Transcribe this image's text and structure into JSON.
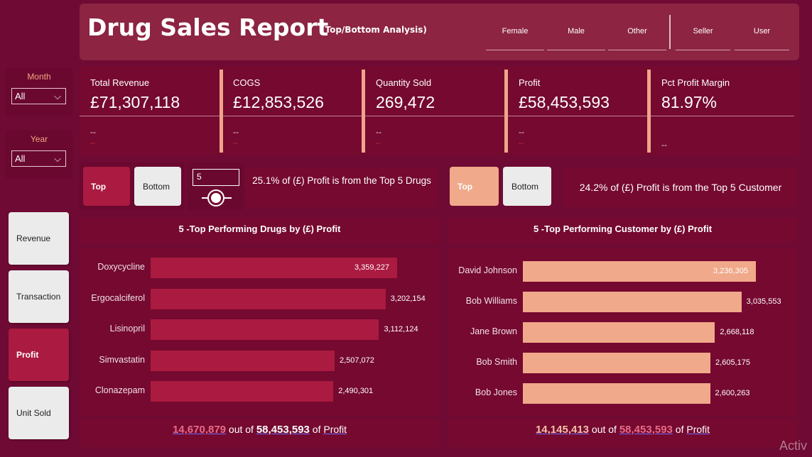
{
  "header": {
    "title": "Drug Sales Report",
    "subtitle": "(Top/Bottom Analysis)",
    "gender_slicers": [
      "Female",
      "Male",
      "Other"
    ],
    "role_slicers": [
      "Seller",
      "User"
    ]
  },
  "filters": {
    "month": {
      "label": "Month",
      "value": "All"
    },
    "year": {
      "label": "Year",
      "value": "All"
    }
  },
  "kpis": [
    {
      "label": "Total Revenue",
      "value": "£71,307,118",
      "dash": "--",
      "dash2": "--"
    },
    {
      "label": "COGS",
      "value": "£12,853,526",
      "dash": "--",
      "dash2": "--"
    },
    {
      "label": "Quantity Sold",
      "value": "269,472",
      "dash": "--",
      "dash2": "--"
    },
    {
      "label": "Profit",
      "value": "£58,453,593",
      "dash": "--",
      "dash2": "--"
    },
    {
      "label": "Pct Profit Margin",
      "value": "81.97%",
      "dash": "--"
    }
  ],
  "nav": [
    "Revenue",
    "Transaction",
    "Profit",
    "Unit Sold"
  ],
  "left": {
    "top_label": "Top",
    "bottom_label": "Bottom",
    "n_value": "5",
    "insight": "25.1% of (£) Profit is from the Top 5 Drugs",
    "chart_title": "5 -Top Performing Drugs by (£) Profit",
    "footer": {
      "part": "14,670,879",
      "out_of": "out of",
      "total": "58,453,593",
      "of": "of",
      "measure": "Profit"
    }
  },
  "right": {
    "top_label": "Top",
    "bottom_label": "Bottom",
    "insight": "24.2% of (£) Profit is from the Top 5 Customer",
    "chart_title": "5 -Top Performing Customer by (£) Profit",
    "footer": {
      "part": "14,145,413",
      "out_of": "out of",
      "total": "58,453,593",
      "of": "of",
      "measure": "Profit"
    }
  },
  "watermark": "Activ",
  "colors": {
    "bg": "#6e0a33",
    "drug_bar": "#ab1a40",
    "customer_bar": "#f0a98a",
    "accent": "#f0a58a"
  },
  "chart_data": [
    {
      "type": "bar",
      "orientation": "horizontal",
      "title": "5 -Top Performing Drugs by (£) Profit",
      "categories": [
        "Doxycycline",
        "Ergocalciferol",
        "Lisinopril",
        "Simvastatin",
        "Clonazepam"
      ],
      "values": [
        3359227,
        3202154,
        3112124,
        2507072,
        2490301
      ],
      "labels": [
        "3,359,227",
        "3,202,154",
        "3,112,124",
        "2,507,072",
        "2,490,301"
      ]
    },
    {
      "type": "bar",
      "orientation": "horizontal",
      "title": "5 -Top Performing Customer by (£) Profit",
      "categories": [
        "David Johnson",
        "Bob Williams",
        "Jane Brown",
        "Bob Smith",
        "Bob Jones"
      ],
      "values": [
        3236305,
        3035553,
        2668118,
        2605175,
        2600263
      ],
      "labels": [
        "3,236,305",
        "3,035,553",
        "2,668,118",
        "2,605,175",
        "2,600,263"
      ]
    }
  ]
}
